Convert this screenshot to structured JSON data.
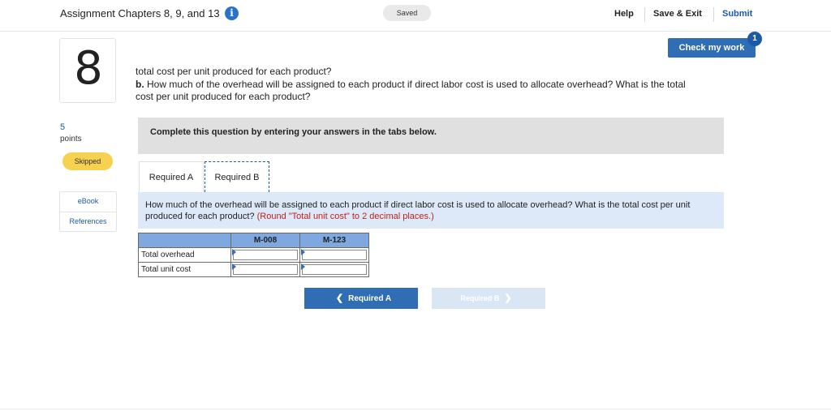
{
  "header": {
    "title": "Assignment Chapters 8, 9, and 13",
    "saved_label": "Saved",
    "help_label": "Help",
    "save_exit_label": "Save & Exit",
    "submit_label": "Submit"
  },
  "sidebar": {
    "question_number": "8",
    "points_value": "5",
    "points_label": "points",
    "status_badge": "Skipped",
    "links": [
      "eBook",
      "References"
    ]
  },
  "check": {
    "label": "Check my work",
    "badge": "1"
  },
  "question": {
    "line1": "total cost per unit produced for each product?",
    "part_b_prefix": "b.",
    "part_b_line1": " How much of the overhead will be assigned to each product if direct labor cost is used to allocate overhead? What is the total",
    "part_b_line2": "cost per unit produced for each product?"
  },
  "instruction": "Complete this question by entering your answers in the tabs below.",
  "tabs": [
    {
      "label": "Required A"
    },
    {
      "label": "Required B"
    }
  ],
  "prompt": {
    "text": "How much of the overhead will be assigned to each product if direct labor cost is used to allocate overhead? What is the total cost per unit produced for each product?",
    "note": "(Round \"Total unit cost\" to 2 decimal places.)"
  },
  "table": {
    "columns": [
      "M-008",
      "M-123"
    ],
    "rows": [
      {
        "label": "Total overhead",
        "values": [
          "",
          ""
        ]
      },
      {
        "label": "Total unit cost",
        "values": [
          "",
          ""
        ]
      }
    ]
  },
  "nav": {
    "prev_label": "Required A",
    "next_label": "Required B"
  }
}
